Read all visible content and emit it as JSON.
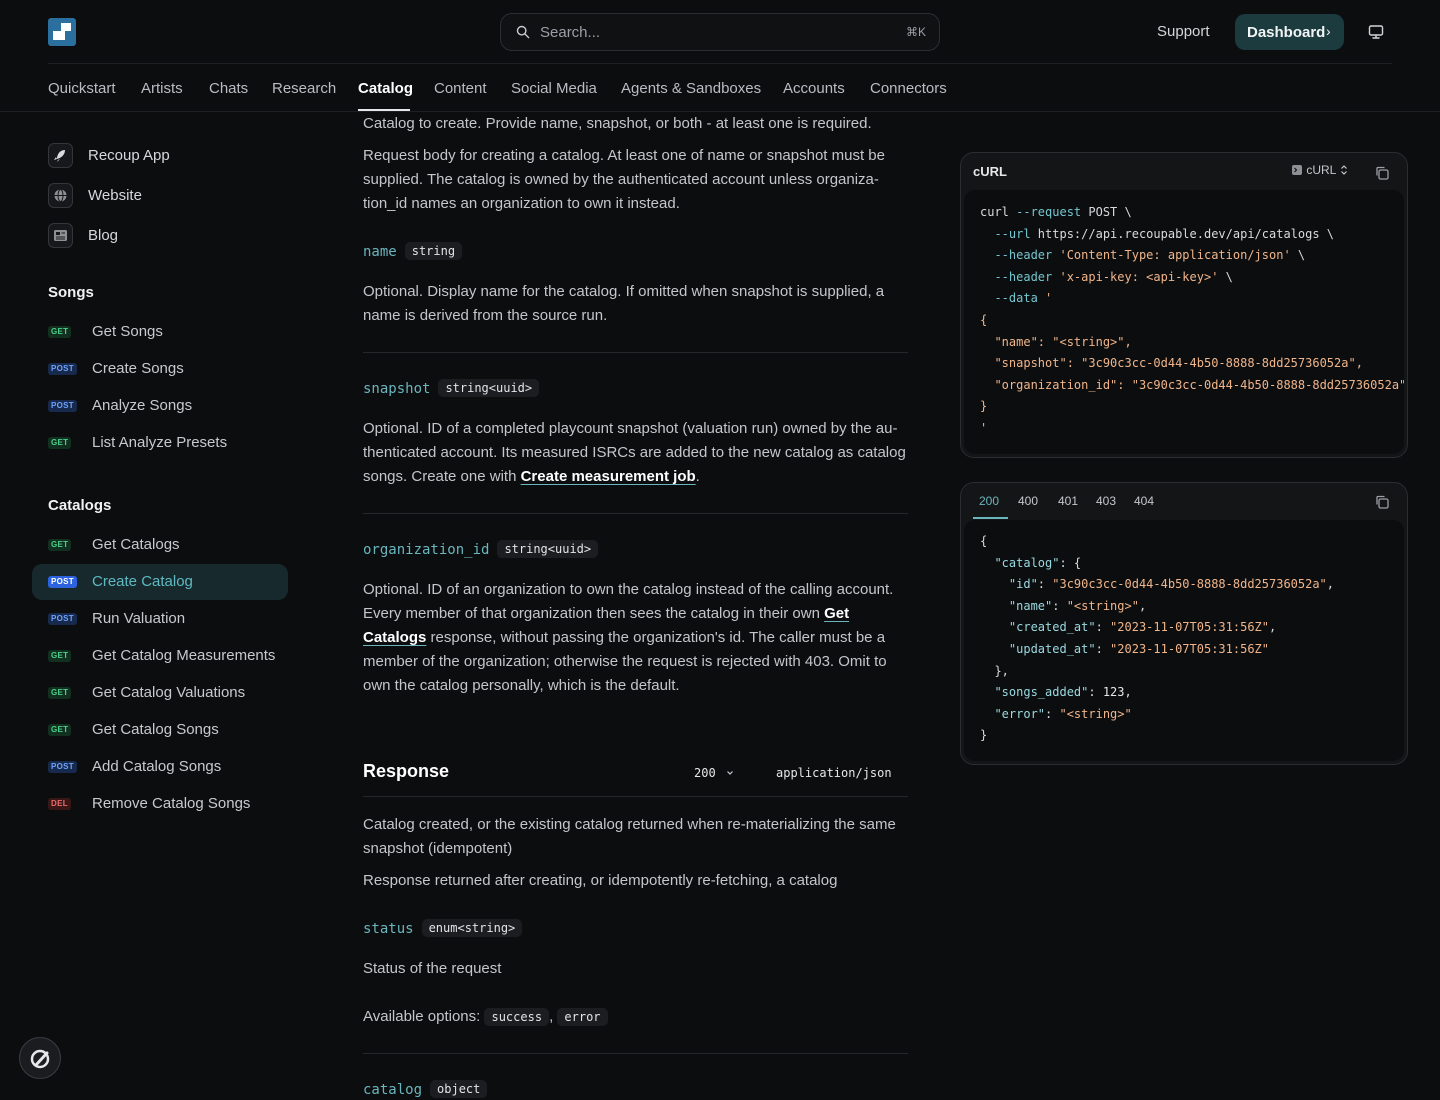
{
  "header": {
    "search_placeholder": "Search...",
    "search_shortcut": "⌘K",
    "support_label": "Support",
    "dashboard_label": "Dashboard",
    "dashboard_chevron": "›"
  },
  "tabs": [
    "Quickstart",
    "Artists",
    "Chats",
    "Research",
    "Catalog",
    "Content",
    "Social Media",
    "Agents & Sandboxes",
    "Accounts",
    "Connectors"
  ],
  "active_tab": "Catalog",
  "sidebar": {
    "links": [
      "Recoup App",
      "Website",
      "Blog"
    ],
    "groups": [
      {
        "title": "Songs",
        "items": [
          {
            "method": "GET",
            "label": "Get Songs"
          },
          {
            "method": "POST",
            "label": "Create Songs"
          },
          {
            "method": "POST",
            "label": "Analyze Songs"
          },
          {
            "method": "GET",
            "label": "List Analyze Presets"
          }
        ]
      },
      {
        "title": "Catalogs",
        "items": [
          {
            "method": "GET",
            "label": "Get Catalogs"
          },
          {
            "method": "POST",
            "label": "Create Catalog",
            "active": true
          },
          {
            "method": "POST",
            "label": "Run Valuation"
          },
          {
            "method": "GET",
            "label": "Get Catalog Measurements"
          },
          {
            "method": "GET",
            "label": "Get Catalog Valuations"
          },
          {
            "method": "GET",
            "label": "Get Catalog Songs"
          },
          {
            "method": "POST",
            "label": "Add Catalog Songs"
          },
          {
            "method": "DEL",
            "label": "Remove Catalog Songs"
          }
        ]
      }
    ]
  },
  "content": {
    "intro": "Catalog to create. Provide name, snapshot, or both - at least one is required.",
    "body_desc": "Request body for creating a catalog. At least one of name or snapshot must be supplied. The catalog is owned by the authenticated account unless organiza-tion_id names an organization to own it instead.",
    "fields": [
      {
        "name": "name",
        "type": "string",
        "desc": "Optional. Display name for the catalog. If omitted when snapshot is supplied, a name is derived from the source run."
      },
      {
        "name": "snapshot",
        "type": "string<uuid>",
        "desc_before": "Optional. ID of a completed playcount snapshot (valuation run) owned by the au-thenticated account. Its measured ISRCs are added to the new catalog as catalog songs. Create one with ",
        "link": "Create measurement job",
        "desc_after": "."
      },
      {
        "name": "organization_id",
        "type": "string<uuid>",
        "desc_before": "Optional. ID of an organization to own the catalog instead of the calling account. Every member of that organization then sees the catalog in their own ",
        "link": "Get Catalogs",
        "desc_after": " response, without passing the organization's id. The caller must be a member of the organization; otherwise the request is rejected with 403. Omit to own the catalog personally, which is the default."
      }
    ],
    "response": {
      "title": "Response",
      "code": "200",
      "content_type": "application/json",
      "desc1": "Catalog created, or the existing catalog returned when re-materializing the same snapshot (idempotent)",
      "desc2": "Response returned after creating, or idempotently re-fetching, a catalog",
      "status_field": {
        "name": "status",
        "type": "enum<string>",
        "desc": "Status of the request"
      },
      "options_label": "Available options:",
      "options": [
        "success",
        "error"
      ],
      "options_sep": ",",
      "catalog_field": {
        "name": "catalog",
        "type": "object"
      }
    }
  },
  "curl_panel": {
    "title": "cURL",
    "lang": "cURL",
    "lines": [
      [
        {
          "t": "curl ",
          "c": "p"
        },
        {
          "t": "--request",
          "c": "f"
        },
        {
          "t": " POST \\",
          "c": "p"
        }
      ],
      [
        {
          "t": "  --url",
          "c": "f"
        },
        {
          "t": " https://api.recoupable.dev/api/catalogs \\",
          "c": "p"
        }
      ],
      [
        {
          "t": "  --header",
          "c": "f"
        },
        {
          "t": " 'Content-Type: application/json'",
          "c": "s"
        },
        {
          "t": " \\",
          "c": "p"
        }
      ],
      [
        {
          "t": "  --header",
          "c": "f"
        },
        {
          "t": " 'x-api-key: <api-key>'",
          "c": "s"
        },
        {
          "t": " \\",
          "c": "p"
        }
      ],
      [
        {
          "t": "  --data",
          "c": "f"
        },
        {
          "t": " '",
          "c": "s"
        }
      ],
      [
        {
          "t": "{",
          "c": "s"
        }
      ],
      [
        {
          "t": "  \"name\"",
          "c": "s"
        },
        {
          "t": ": ",
          "c": "s"
        },
        {
          "t": "\"<string>\"",
          "c": "s"
        },
        {
          "t": ",",
          "c": "s"
        }
      ],
      [
        {
          "t": "  \"snapshot\"",
          "c": "s"
        },
        {
          "t": ": ",
          "c": "s"
        },
        {
          "t": "\"3c90c3cc-0d44-4b50-8888-8dd25736052a\"",
          "c": "s"
        },
        {
          "t": ",",
          "c": "s"
        }
      ],
      [
        {
          "t": "  \"organization_id\"",
          "c": "s"
        },
        {
          "t": ": ",
          "c": "s"
        },
        {
          "t": "\"3c90c3cc-0d44-4b50-8888-8dd25736052a\"",
          "c": "s"
        }
      ],
      [
        {
          "t": "}",
          "c": "s"
        }
      ],
      [
        {
          "t": "'",
          "c": "s"
        }
      ]
    ]
  },
  "response_panel": {
    "tabs": [
      "200",
      "400",
      "401",
      "403",
      "404"
    ],
    "active": "200",
    "lines": [
      [
        {
          "t": "{",
          "c": "p"
        }
      ],
      [
        {
          "t": "  \"catalog\"",
          "c": "k"
        },
        {
          "t": ": {",
          "c": "p"
        }
      ],
      [
        {
          "t": "    \"id\"",
          "c": "k"
        },
        {
          "t": ": ",
          "c": "p"
        },
        {
          "t": "\"3c90c3cc-0d44-4b50-8888-8dd25736052a\"",
          "c": "s"
        },
        {
          "t": ",",
          "c": "p"
        }
      ],
      [
        {
          "t": "    \"name\"",
          "c": "k"
        },
        {
          "t": ": ",
          "c": "p"
        },
        {
          "t": "\"<string>\"",
          "c": "s"
        },
        {
          "t": ",",
          "c": "p"
        }
      ],
      [
        {
          "t": "    \"created_at\"",
          "c": "k"
        },
        {
          "t": ": ",
          "c": "p"
        },
        {
          "t": "\"2023-11-07T05:31:56Z\"",
          "c": "s"
        },
        {
          "t": ",",
          "c": "p"
        }
      ],
      [
        {
          "t": "    \"updated_at\"",
          "c": "k"
        },
        {
          "t": ": ",
          "c": "p"
        },
        {
          "t": "\"2023-11-07T05:31:56Z\"",
          "c": "s"
        }
      ],
      [
        {
          "t": "  },",
          "c": "p"
        }
      ],
      [
        {
          "t": "  \"songs_added\"",
          "c": "k"
        },
        {
          "t": ": ",
          "c": "p"
        },
        {
          "t": "123",
          "c": "n"
        },
        {
          "t": ",",
          "c": "p"
        }
      ],
      [
        {
          "t": "  \"error\"",
          "c": "k"
        },
        {
          "t": ": ",
          "c": "p"
        },
        {
          "t": "\"<string>\"",
          "c": "s"
        }
      ],
      [
        {
          "t": "}",
          "c": "p"
        }
      ]
    ]
  }
}
